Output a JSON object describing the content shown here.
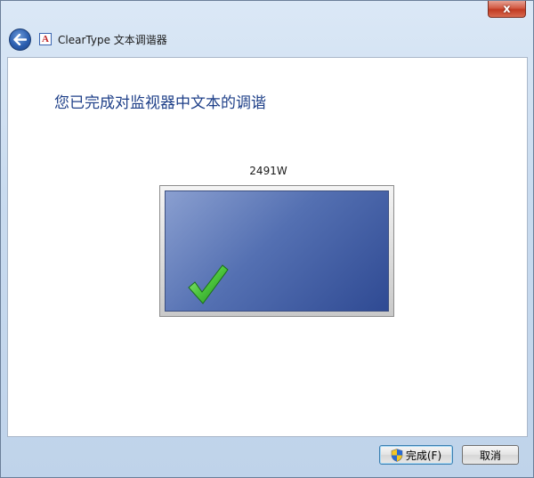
{
  "window": {
    "close_label": "x",
    "close_icon": "close-icon"
  },
  "nav": {
    "back_icon": "back-arrow-icon",
    "app_icon": "cleartype-app-icon",
    "app_icon_glyph": "A",
    "title": "ClearType 文本调谐器"
  },
  "main": {
    "heading": "您已完成对监视器中文本的调谐",
    "monitor_name": "2491W",
    "status_icon": "checkmark-icon"
  },
  "footer": {
    "finish_label": "完成(F)",
    "finish_icon": "uac-shield-icon",
    "cancel_label": "取消"
  },
  "colors": {
    "heading": "#1e3f88",
    "screen": "#4a63a8",
    "checkmark": "#4cc43c"
  }
}
